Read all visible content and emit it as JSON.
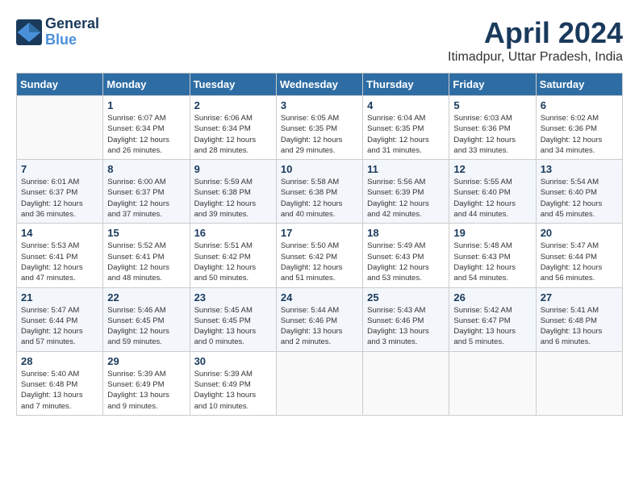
{
  "header": {
    "logo_line1": "General",
    "logo_line2": "Blue",
    "title": "April 2024",
    "subtitle": "Itimadpur, Uttar Pradesh, India"
  },
  "columns": [
    "Sunday",
    "Monday",
    "Tuesday",
    "Wednesday",
    "Thursday",
    "Friday",
    "Saturday"
  ],
  "weeks": [
    [
      {
        "day": "",
        "info": ""
      },
      {
        "day": "1",
        "info": "Sunrise: 6:07 AM\nSunset: 6:34 PM\nDaylight: 12 hours\nand 26 minutes."
      },
      {
        "day": "2",
        "info": "Sunrise: 6:06 AM\nSunset: 6:34 PM\nDaylight: 12 hours\nand 28 minutes."
      },
      {
        "day": "3",
        "info": "Sunrise: 6:05 AM\nSunset: 6:35 PM\nDaylight: 12 hours\nand 29 minutes."
      },
      {
        "day": "4",
        "info": "Sunrise: 6:04 AM\nSunset: 6:35 PM\nDaylight: 12 hours\nand 31 minutes."
      },
      {
        "day": "5",
        "info": "Sunrise: 6:03 AM\nSunset: 6:36 PM\nDaylight: 12 hours\nand 33 minutes."
      },
      {
        "day": "6",
        "info": "Sunrise: 6:02 AM\nSunset: 6:36 PM\nDaylight: 12 hours\nand 34 minutes."
      }
    ],
    [
      {
        "day": "7",
        "info": "Sunrise: 6:01 AM\nSunset: 6:37 PM\nDaylight: 12 hours\nand 36 minutes."
      },
      {
        "day": "8",
        "info": "Sunrise: 6:00 AM\nSunset: 6:37 PM\nDaylight: 12 hours\nand 37 minutes."
      },
      {
        "day": "9",
        "info": "Sunrise: 5:59 AM\nSunset: 6:38 PM\nDaylight: 12 hours\nand 39 minutes."
      },
      {
        "day": "10",
        "info": "Sunrise: 5:58 AM\nSunset: 6:38 PM\nDaylight: 12 hours\nand 40 minutes."
      },
      {
        "day": "11",
        "info": "Sunrise: 5:56 AM\nSunset: 6:39 PM\nDaylight: 12 hours\nand 42 minutes."
      },
      {
        "day": "12",
        "info": "Sunrise: 5:55 AM\nSunset: 6:40 PM\nDaylight: 12 hours\nand 44 minutes."
      },
      {
        "day": "13",
        "info": "Sunrise: 5:54 AM\nSunset: 6:40 PM\nDaylight: 12 hours\nand 45 minutes."
      }
    ],
    [
      {
        "day": "14",
        "info": "Sunrise: 5:53 AM\nSunset: 6:41 PM\nDaylight: 12 hours\nand 47 minutes."
      },
      {
        "day": "15",
        "info": "Sunrise: 5:52 AM\nSunset: 6:41 PM\nDaylight: 12 hours\nand 48 minutes."
      },
      {
        "day": "16",
        "info": "Sunrise: 5:51 AM\nSunset: 6:42 PM\nDaylight: 12 hours\nand 50 minutes."
      },
      {
        "day": "17",
        "info": "Sunrise: 5:50 AM\nSunset: 6:42 PM\nDaylight: 12 hours\nand 51 minutes."
      },
      {
        "day": "18",
        "info": "Sunrise: 5:49 AM\nSunset: 6:43 PM\nDaylight: 12 hours\nand 53 minutes."
      },
      {
        "day": "19",
        "info": "Sunrise: 5:48 AM\nSunset: 6:43 PM\nDaylight: 12 hours\nand 54 minutes."
      },
      {
        "day": "20",
        "info": "Sunrise: 5:47 AM\nSunset: 6:44 PM\nDaylight: 12 hours\nand 56 minutes."
      }
    ],
    [
      {
        "day": "21",
        "info": "Sunrise: 5:47 AM\nSunset: 6:44 PM\nDaylight: 12 hours\nand 57 minutes."
      },
      {
        "day": "22",
        "info": "Sunrise: 5:46 AM\nSunset: 6:45 PM\nDaylight: 12 hours\nand 59 minutes."
      },
      {
        "day": "23",
        "info": "Sunrise: 5:45 AM\nSunset: 6:45 PM\nDaylight: 13 hours\nand 0 minutes."
      },
      {
        "day": "24",
        "info": "Sunrise: 5:44 AM\nSunset: 6:46 PM\nDaylight: 13 hours\nand 2 minutes."
      },
      {
        "day": "25",
        "info": "Sunrise: 5:43 AM\nSunset: 6:46 PM\nDaylight: 13 hours\nand 3 minutes."
      },
      {
        "day": "26",
        "info": "Sunrise: 5:42 AM\nSunset: 6:47 PM\nDaylight: 13 hours\nand 5 minutes."
      },
      {
        "day": "27",
        "info": "Sunrise: 5:41 AM\nSunset: 6:48 PM\nDaylight: 13 hours\nand 6 minutes."
      }
    ],
    [
      {
        "day": "28",
        "info": "Sunrise: 5:40 AM\nSunset: 6:48 PM\nDaylight: 13 hours\nand 7 minutes."
      },
      {
        "day": "29",
        "info": "Sunrise: 5:39 AM\nSunset: 6:49 PM\nDaylight: 13 hours\nand 9 minutes."
      },
      {
        "day": "30",
        "info": "Sunrise: 5:39 AM\nSunset: 6:49 PM\nDaylight: 13 hours\nand 10 minutes."
      },
      {
        "day": "",
        "info": ""
      },
      {
        "day": "",
        "info": ""
      },
      {
        "day": "",
        "info": ""
      },
      {
        "day": "",
        "info": ""
      }
    ]
  ]
}
